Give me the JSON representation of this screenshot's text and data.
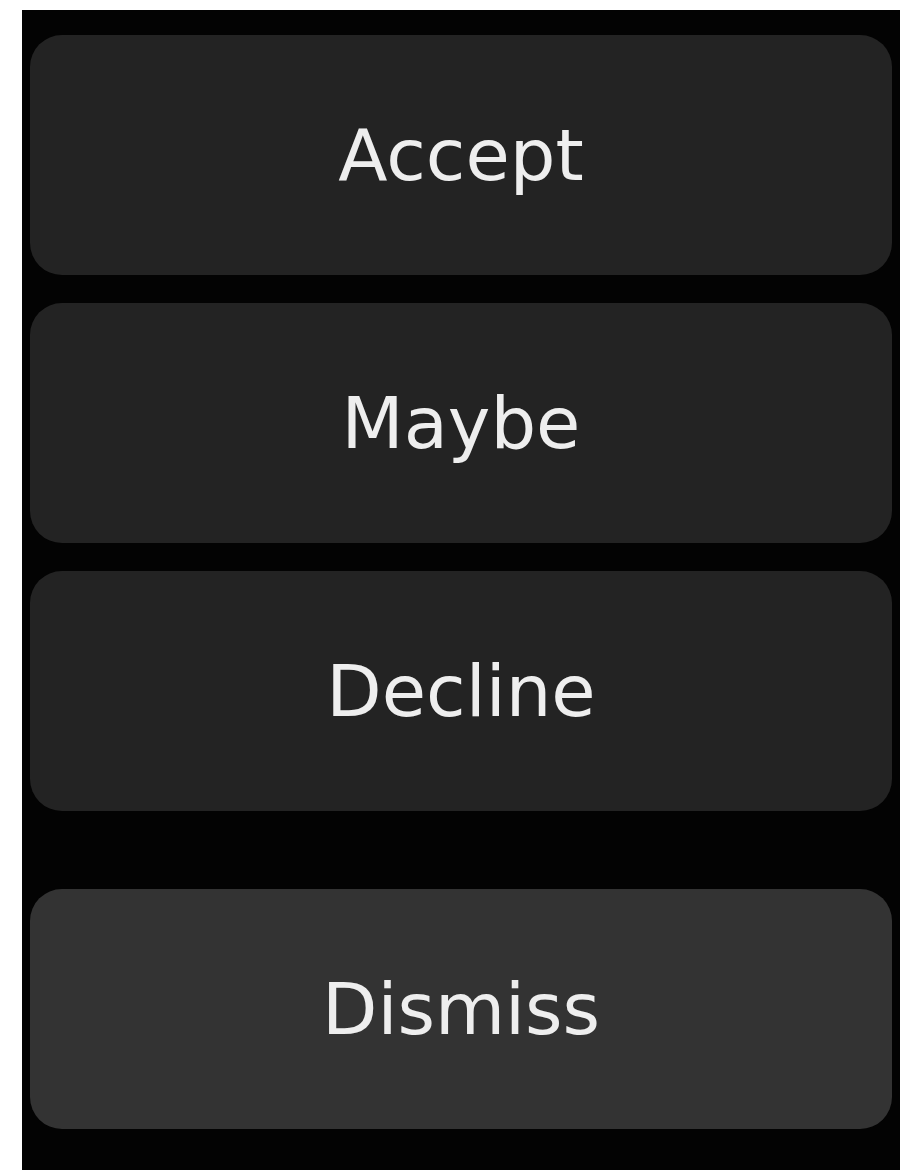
{
  "buttons": [
    {
      "label": "Accept",
      "kind": "action"
    },
    {
      "label": "Maybe",
      "kind": "action"
    },
    {
      "label": "Decline",
      "kind": "action"
    },
    {
      "label": "Dismiss",
      "kind": "dismiss"
    }
  ]
}
